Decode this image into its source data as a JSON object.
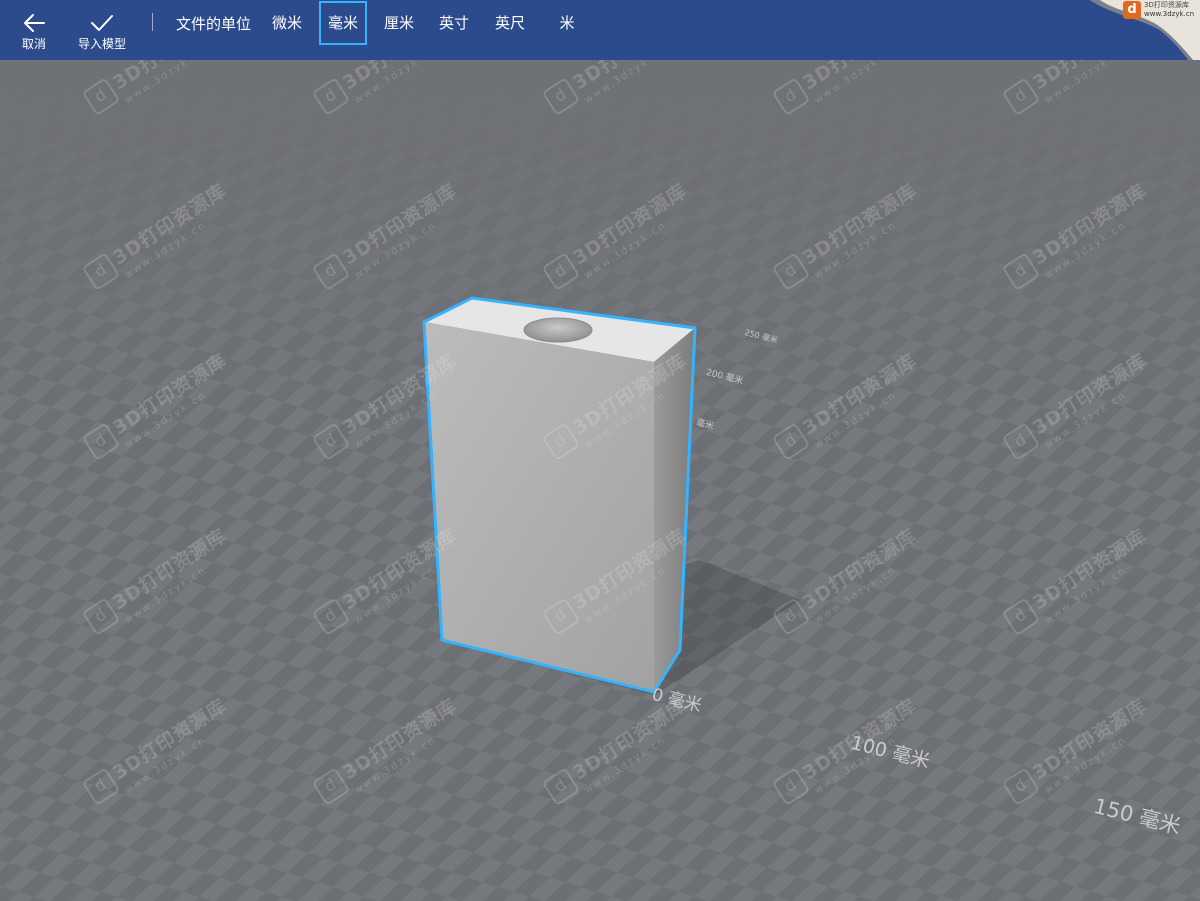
{
  "toolbar": {
    "cancel_label": "取消",
    "import_label": "导入模型",
    "units_caption": "文件的单位",
    "units": [
      "微米",
      "毫米",
      "厘米",
      "英寸",
      "英尺",
      "米"
    ],
    "selected_unit": "毫米"
  },
  "viewport": {
    "scale_labels": {
      "near": "0 毫米",
      "mid": "100 毫米",
      "far": "150 毫米",
      "back_200": "200 毫米",
      "back_250": "250 毫米",
      "back_near": "毫米"
    }
  },
  "watermark": {
    "brand": "3D打印资源库",
    "url": "www.3dzyk.cn",
    "logo_glyph": "d"
  },
  "logo": {
    "glyph": "d",
    "title": "3D打印资源库",
    "url": "www.3dzyk.cn"
  },
  "colors": {
    "toolbar_bg": "#2b4b8d",
    "selection_outline": "#35b3ff",
    "floor_dark": "#5d6064",
    "floor_light": "#7a7d80"
  }
}
